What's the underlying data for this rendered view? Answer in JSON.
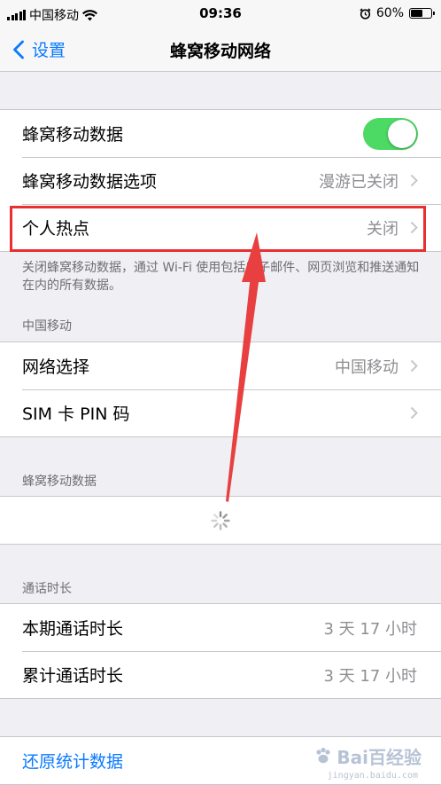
{
  "status_bar": {
    "carrier": "中国移动",
    "time": "09:36",
    "battery_percent": "60%",
    "battery_level": 0.6,
    "icons": [
      "signal-icon",
      "wifi-icon",
      "alarm-icon",
      "battery-icon"
    ]
  },
  "nav": {
    "back_label": "设置",
    "title": "蜂窝移动网络"
  },
  "section1": {
    "rows": [
      {
        "label": "蜂窝移动数据",
        "toggle_on": true
      },
      {
        "label": "蜂窝移动数据选项",
        "value": "漫游已关闭"
      },
      {
        "label": "个人热点",
        "value": "关闭"
      }
    ],
    "footer": "关闭蜂窝移动数据，通过 Wi-Fi 使用包括电子邮件、网页浏览和推送通知在内的所有数据。"
  },
  "section2": {
    "header": "中国移动",
    "rows": [
      {
        "label": "网络选择",
        "value": "中国移动"
      },
      {
        "label": "SIM 卡 PIN 码"
      }
    ]
  },
  "section3": {
    "header": "蜂窝移动数据"
  },
  "section4": {
    "header": "通话时长",
    "rows": [
      {
        "label": "本期通话时长",
        "value": "3 天 17 小时"
      },
      {
        "label": "累计通话时长",
        "value": "3 天 17 小时"
      }
    ]
  },
  "section5": {
    "action_label": "还原统计数据"
  },
  "watermark": {
    "text": "Bai百经验",
    "sub": "jingyan.baidu.com"
  },
  "colors": {
    "accent": "#0a7aff",
    "toggle_on": "#4cd964",
    "highlight": "#e83030"
  }
}
